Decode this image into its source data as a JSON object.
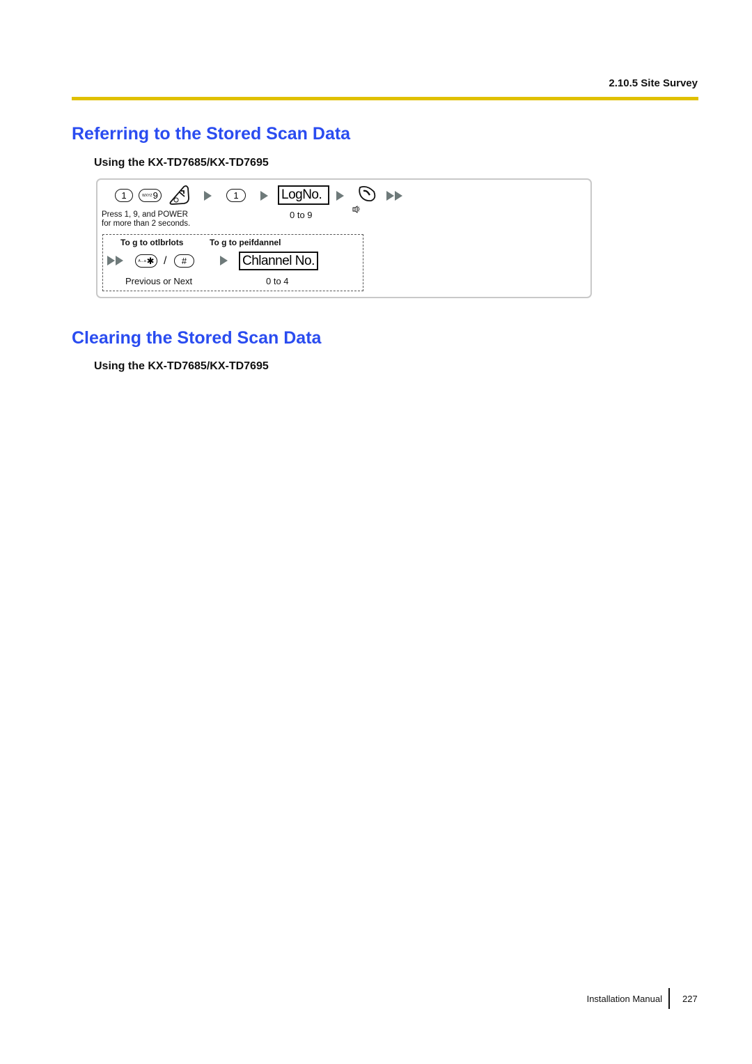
{
  "header": {
    "section_label": "2.10.5 Site Survey",
    "rule_color": "#e0c000"
  },
  "sections": [
    {
      "title": "Referring to the Stored Scan Data",
      "subtitle": "Using the KX-TD7685/KX-TD7695",
      "procedure": {
        "step1": {
          "keys": [
            "1",
            "9",
            "POWER"
          ],
          "key_1_label": "1",
          "key_9_sub": "WXYZ",
          "key_9_label": "9",
          "power_icon": "power-key-icon",
          "caption_line1": "Press 1, 9, and POWER",
          "caption_line2": "for more than 2 seconds."
        },
        "step2": {
          "key_label": "1"
        },
        "step3": {
          "field_label": "LogNo.",
          "field_label_overlay": "g",
          "caption": "0 to 9"
        },
        "step4": {
          "icon": "talk-key-icon",
          "sub_icon": "speaker-icon"
        },
        "optional": {
          "heading_left": "To g to otlbrlots",
          "heading_right": "To g to peifdannel",
          "star_key_sub": "A↔a",
          "star_key_label": "✱",
          "separator": "/",
          "hash_key_label": "#",
          "caption_left": "Previous or Next",
          "field_label": "Chlannel No.",
          "caption_right": "0 to 4"
        }
      }
    },
    {
      "title": "Clearing the Stored Scan Data",
      "subtitle": "Using the KX-TD7685/KX-TD7695"
    }
  ],
  "footer": {
    "label": "Installation Manual",
    "page_number": "227"
  },
  "colors": {
    "heading_blue": "#2a4cf0",
    "arrow_gray": "#6e7a7a",
    "rule_yellow": "#e0c000"
  }
}
